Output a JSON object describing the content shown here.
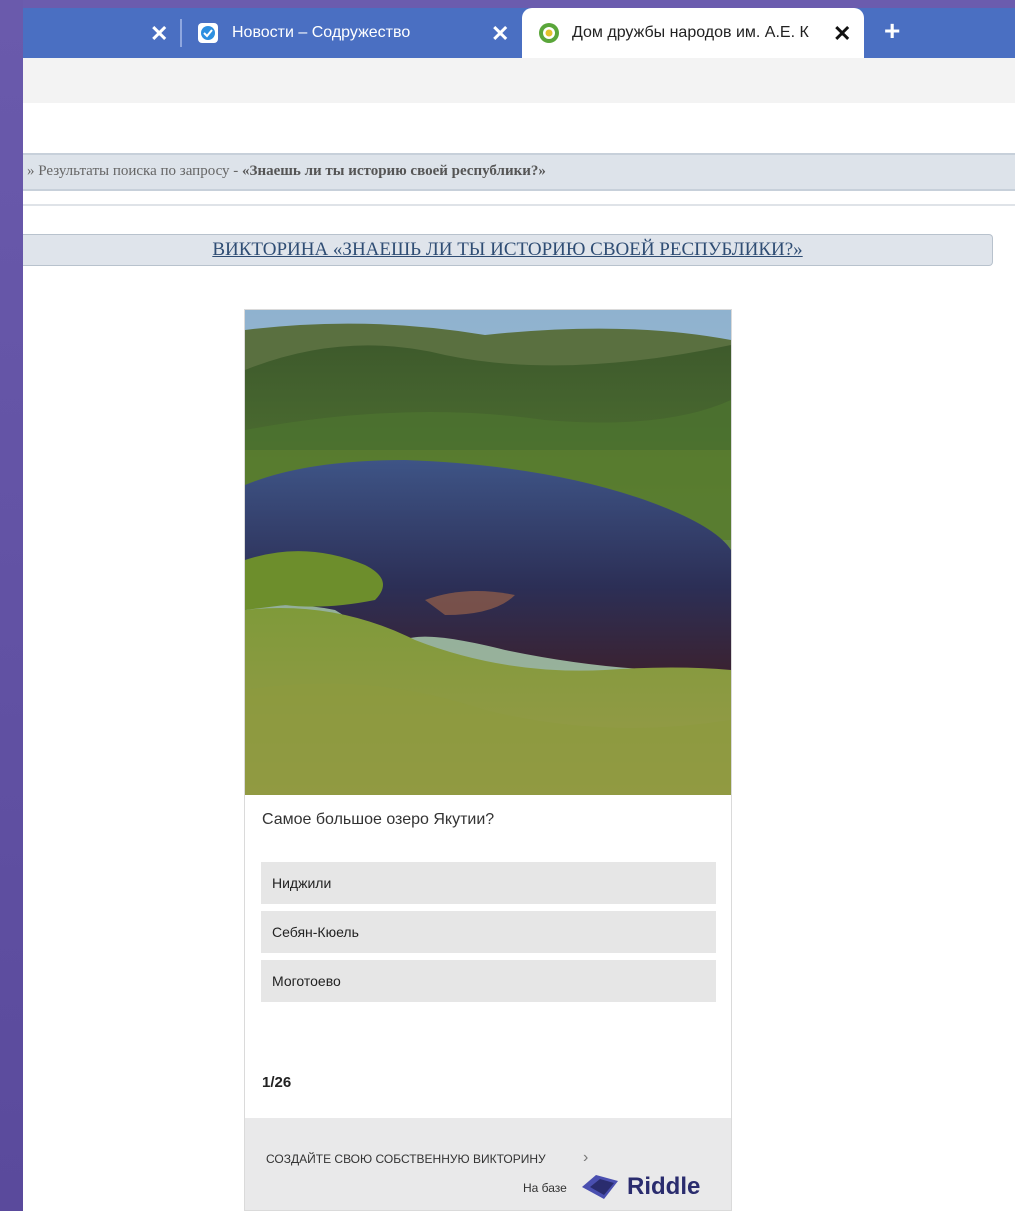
{
  "browser": {
    "tabs": [
      {
        "title": "Новости – Содружество",
        "active": false,
        "icon": "shield-badge-icon"
      },
      {
        "title": "Дом дружбы народов им. А.Е. К",
        "active": true,
        "icon": "green-leaf-icon"
      }
    ],
    "close_glyph": "✕",
    "new_tab_glyph": "+"
  },
  "page": {
    "breadcrumb": {
      "prefix": "» Результаты поиска по запросу - ",
      "query": "«Знаешь ли ты историю своей республики?»"
    },
    "quiz_title": "ВИКТОРИНА «ЗНАЕШЬ ЛИ ТЫ ИСТОРИЮ СВОЕЙ РЕСПУБЛИКИ?»"
  },
  "quiz": {
    "question": "Самое большое озеро Якутии?",
    "answers": [
      "Ниджили",
      "Себян-Кюель",
      "Моготоево"
    ],
    "progress": "1/26",
    "footer": {
      "create_label": "СОЗДАЙТЕ СВОЮ СОБСТВЕННУЮ ВИКТОРИНУ",
      "arrow": "›",
      "powered_by": "На базе",
      "brand": "Riddle"
    }
  },
  "colors": {
    "accent_purple": "#5d4fa0",
    "tab_strip": "#4a6fc2",
    "riddle_brand": "#2a2c6e"
  }
}
